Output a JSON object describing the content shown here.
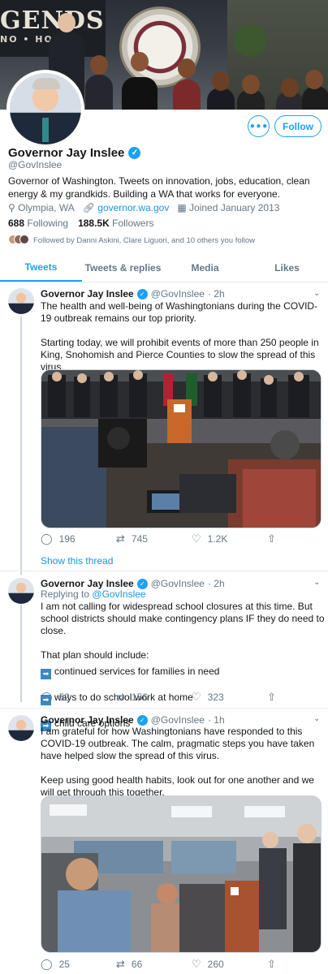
{
  "banner": {
    "sign_text": "GENDS",
    "sign_sub": "NO • HOT",
    "seal_text": "AFFILIATED TRIBES"
  },
  "profile": {
    "name": "Governor Jay Inslee",
    "handle": "@GovInslee",
    "bio": "Governor of Washington. Tweets on innovation, jobs, education, clean energy & my grandkids. Building a WA that works for everyone.",
    "location": "Olympia, WA",
    "website": "governor.wa.gov",
    "joined": "Joined January 2013",
    "following_count": "688",
    "following_label": "Following",
    "followers_count": "188.5K",
    "followers_label": "Followers",
    "followed_by": "Followed by Danni Askini, Clare Liguori, and 10 others you follow",
    "follow_label": "Follow",
    "more_label": "•••"
  },
  "tabs": [
    {
      "label": "Tweets"
    },
    {
      "label": "Tweets & replies"
    },
    {
      "label": "Media"
    },
    {
      "label": "Likes"
    }
  ],
  "tweets": [
    {
      "name": "Governor Jay Inslee",
      "handle": "@GovInslee",
      "time": "· 2h",
      "text": "The health and well-being of Washingtonians during the COVID-19 outbreak remains our top priority.\n\nStarting today, we will prohibit events of more than 250 people in King, Snohomish and Pierce Counties to slow the spread of this virus.",
      "replies": "196",
      "retweets": "745",
      "likes": "1.2K"
    },
    {
      "name": "Governor Jay Inslee",
      "handle": "@GovInslee",
      "time": "· 2h",
      "replying_prefix": "Replying to",
      "replying_handle": "@GovInslee",
      "text": "I am not calling for widespread school closures at this time. But school districts should make contingency plans IF they do need to close.\n\nThat plan should include:",
      "bullets": [
        "continued services for families in need",
        "ways to do school work at home",
        "child care options"
      ],
      "replies": "52",
      "retweets": "156",
      "likes": "323"
    },
    {
      "name": "Governor Jay Inslee",
      "handle": "@GovInslee",
      "time": "· 1h",
      "text": "I am grateful for how Washingtonians have responded to this COVID-19 outbreak. The calm, pragmatic steps you have taken have helped slow the spread of this virus.\n\nKeep using good health habits, look out for one another and we will get through this together.",
      "replies": "25",
      "retweets": "66",
      "likes": "260"
    }
  ],
  "show_thread": "Show this thread",
  "icons": {
    "location": "location-pin-icon",
    "link": "link-icon",
    "calendar": "calendar-icon",
    "reply": "reply-icon",
    "retweet": "retweet-icon",
    "like": "heart-icon",
    "share": "share-icon",
    "verified": "verified-badge-icon",
    "caret": "chevron-down-icon",
    "bullet": "right-arrow-emoji-icon"
  },
  "colors": {
    "accent": "#1da1f2",
    "text": "#14171a",
    "muted": "#657786",
    "link": "#1b95e0"
  }
}
